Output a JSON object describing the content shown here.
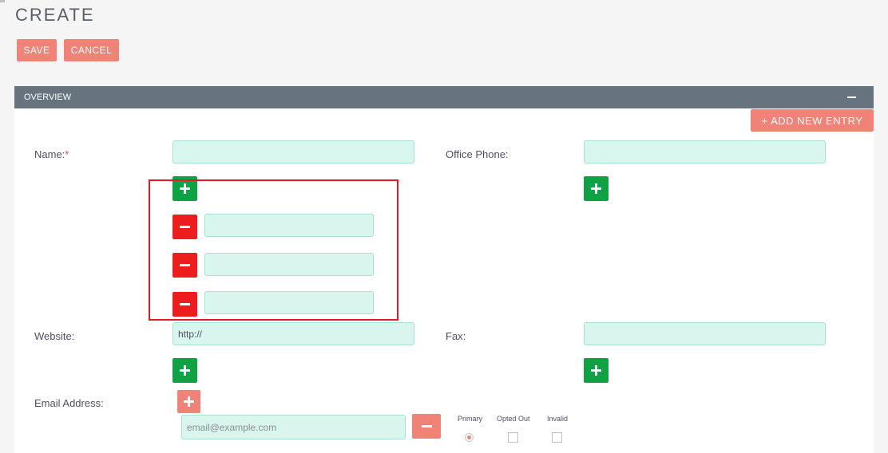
{
  "page": {
    "title": "CREATE"
  },
  "actions": {
    "save_label": "SAVE",
    "cancel_label": "CANCEL"
  },
  "panel": {
    "title": "OVERVIEW",
    "add_entry_label": "+ ADD NEW ENTRY"
  },
  "fields": {
    "name": {
      "label": "Name:",
      "required_mark": "*",
      "value": "",
      "extra_values": [
        "",
        "",
        ""
      ]
    },
    "office_phone": {
      "label": "Office Phone:",
      "value": ""
    },
    "website": {
      "label": "Website:",
      "value": "http://"
    },
    "fax": {
      "label": "Fax:",
      "value": ""
    },
    "email": {
      "label": "Email Address:",
      "placeholder": "email@example.com",
      "value": "",
      "options": {
        "primary": "Primary",
        "opted_out": "Opted Out",
        "invalid": "Invalid"
      },
      "primary_selected": true,
      "opted_out_checked": false,
      "invalid_checked": false
    }
  },
  "icons": {
    "add": "plus-icon",
    "remove": "minus-icon",
    "collapse": "collapse-minus-icon"
  },
  "colors": {
    "accent": "#f08377",
    "panel_header": "#677480",
    "field_bg": "#d8f5ee",
    "add_green": "#0ea245",
    "remove_red": "#ee1d1d",
    "highlight": "#e41b23"
  }
}
